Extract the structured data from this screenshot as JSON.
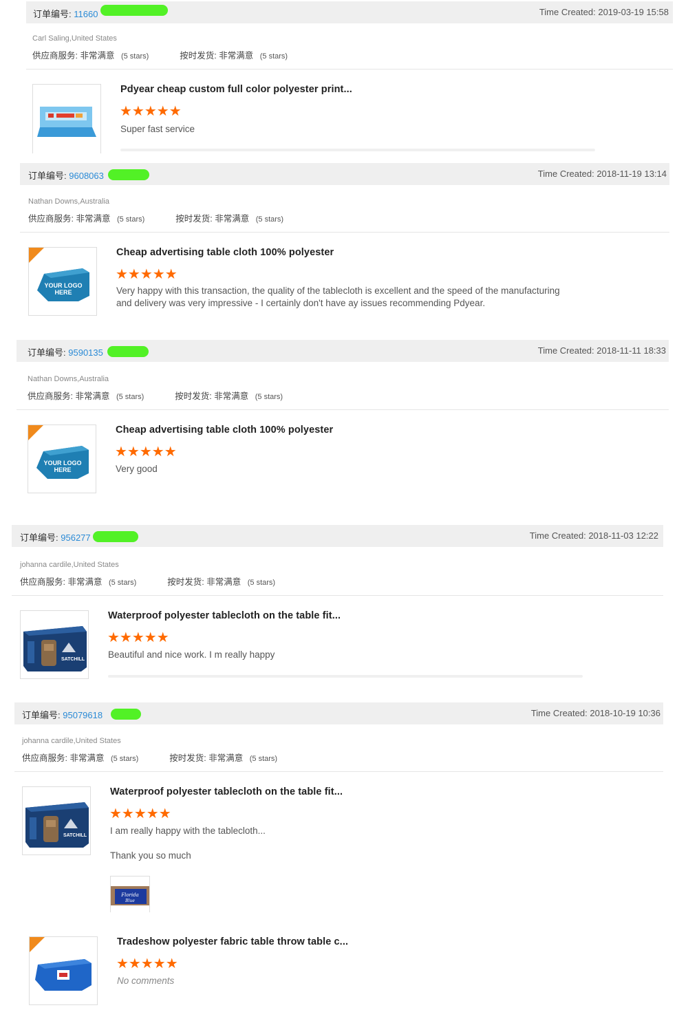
{
  "common": {
    "order_prefix": "订单编号:",
    "time_prefix": "Time Created:",
    "supplier_label": "供应商服务:",
    "shipping_label": "按时发货:",
    "rating_value": "非常满意",
    "stars_text": "(5 stars)",
    "star_glyphs": "★★★★★",
    "accent_color": "#ff6a00",
    "link_color": "#2a8ad6"
  },
  "reviews": [
    {
      "order_number": "11660",
      "time": "2019-03-19 15:58",
      "buyer": "Carl Saling,United States",
      "product_title": "Pdyear cheap custom full color polyester print...",
      "comment": "Super fast service",
      "thumb_icon": "printed-tablecloth-photo"
    },
    {
      "order_number": "9608063",
      "time": "2018-11-19 13:14",
      "buyer": "Nathan Downs,Australia",
      "product_title": "Cheap advertising table cloth 100% polyester",
      "comment": "Very happy with this transaction, the quality of the tablecloth is excellent and the speed of the manufacturing and delivery was very impressive - I certainly don't have ay issues recommending Pdyear.",
      "thumb_icon": "blue-tablecloth-your-logo"
    },
    {
      "order_number": "9590135",
      "time": "2018-11-11 18:33",
      "buyer": "Nathan Downs,Australia",
      "product_title": "Cheap advertising table cloth 100% polyester",
      "comment": "Very good",
      "thumb_icon": "blue-tablecloth-your-logo"
    },
    {
      "order_number": "956277",
      "time": "2018-11-03 12:22",
      "buyer": "johanna cardile,United States",
      "product_title": "Waterproof polyester tablecloth on the table fit...",
      "comment": "Beautiful and nice work. I m really happy",
      "thumb_icon": "satchill-tablecloth"
    },
    {
      "order_number": "95079618",
      "time": "2018-10-19 10:36",
      "buyer": "johanna cardile,United States",
      "product_title": "Waterproof polyester tablecloth on the table fit...",
      "comment": "I am really happy with the tablecloth...",
      "comment2": "Thank you so much",
      "thumb_icon": "satchill-tablecloth",
      "photo_icon": "florida-tablecloth-photo"
    }
  ],
  "extra_product": {
    "product_title": "Tradeshow polyester fabric table throw table c...",
    "comment": "No comments",
    "thumb_icon": "blue-tablecloth-logo"
  }
}
